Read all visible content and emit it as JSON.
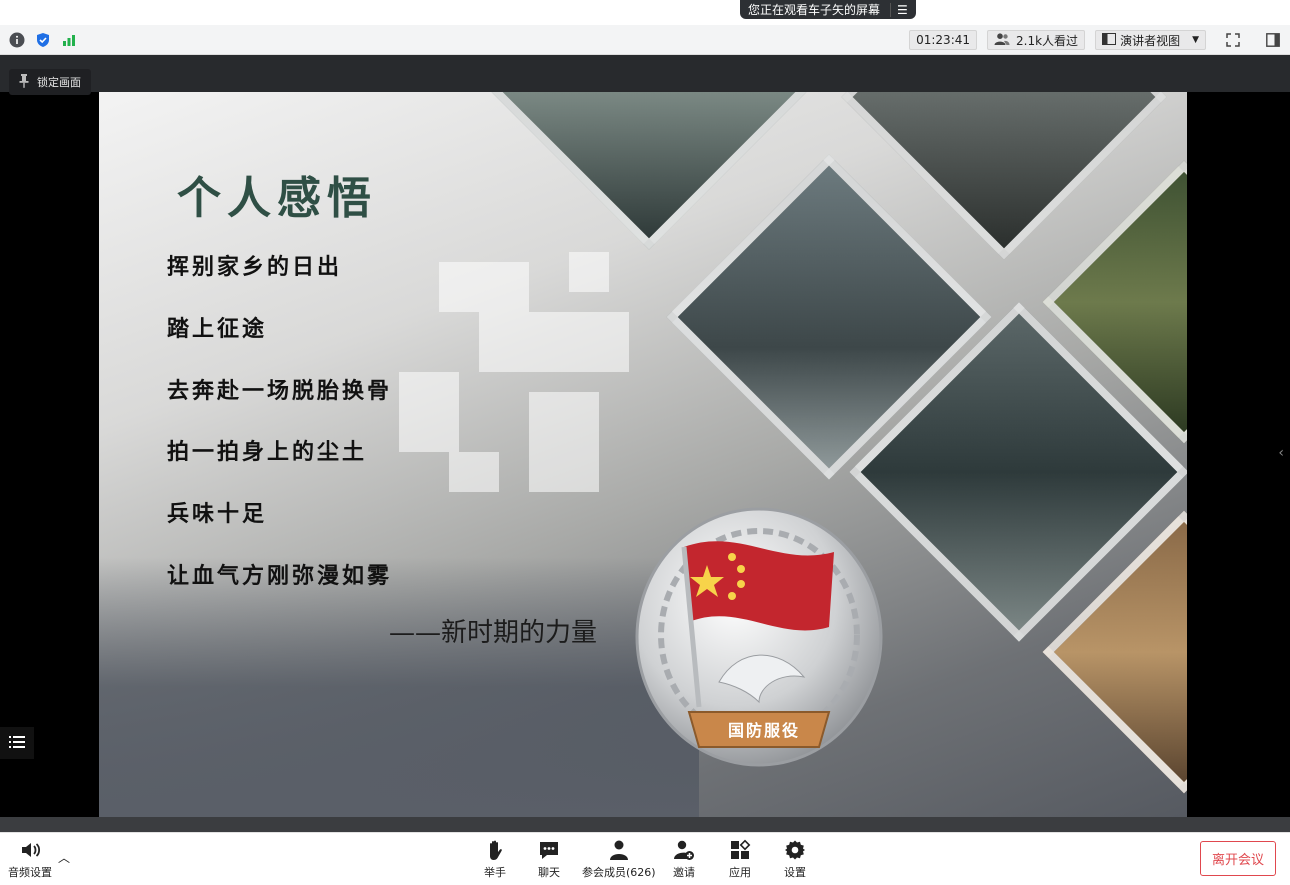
{
  "share_banner": {
    "text": "您正在观看车子矢的屏幕",
    "menu_icon": "list-icon"
  },
  "infobar": {
    "icons": [
      "info-icon",
      "shield-icon",
      "signal-icon"
    ],
    "timer": "01:23:41",
    "viewers": "2.1k人看过",
    "view_mode": "演讲者视图"
  },
  "stage": {
    "lock_label": "锁定画面"
  },
  "slide": {
    "title": "个人感悟",
    "lines": [
      "挥别家乡的日出",
      "踏上征途",
      "去奔赴一场脱胎换骨",
      "拍一拍身上的尘土",
      "兵味十足",
      "让血气方刚弥漫如雾"
    ],
    "tagline": "——新时期的力量",
    "badge_text": "国防服役"
  },
  "toolbar": {
    "audio": "音频设置",
    "raise_hand": "举手",
    "chat": "聊天",
    "participants": "参会成员(626)",
    "invite": "邀请",
    "apps": "应用",
    "settings": "设置",
    "leave": "离开会议"
  },
  "colors": {
    "leave_red": "#e0484e",
    "title_green": "#2f4f45",
    "signal_green": "#22b14c",
    "shield_blue": "#1f6fe5"
  }
}
